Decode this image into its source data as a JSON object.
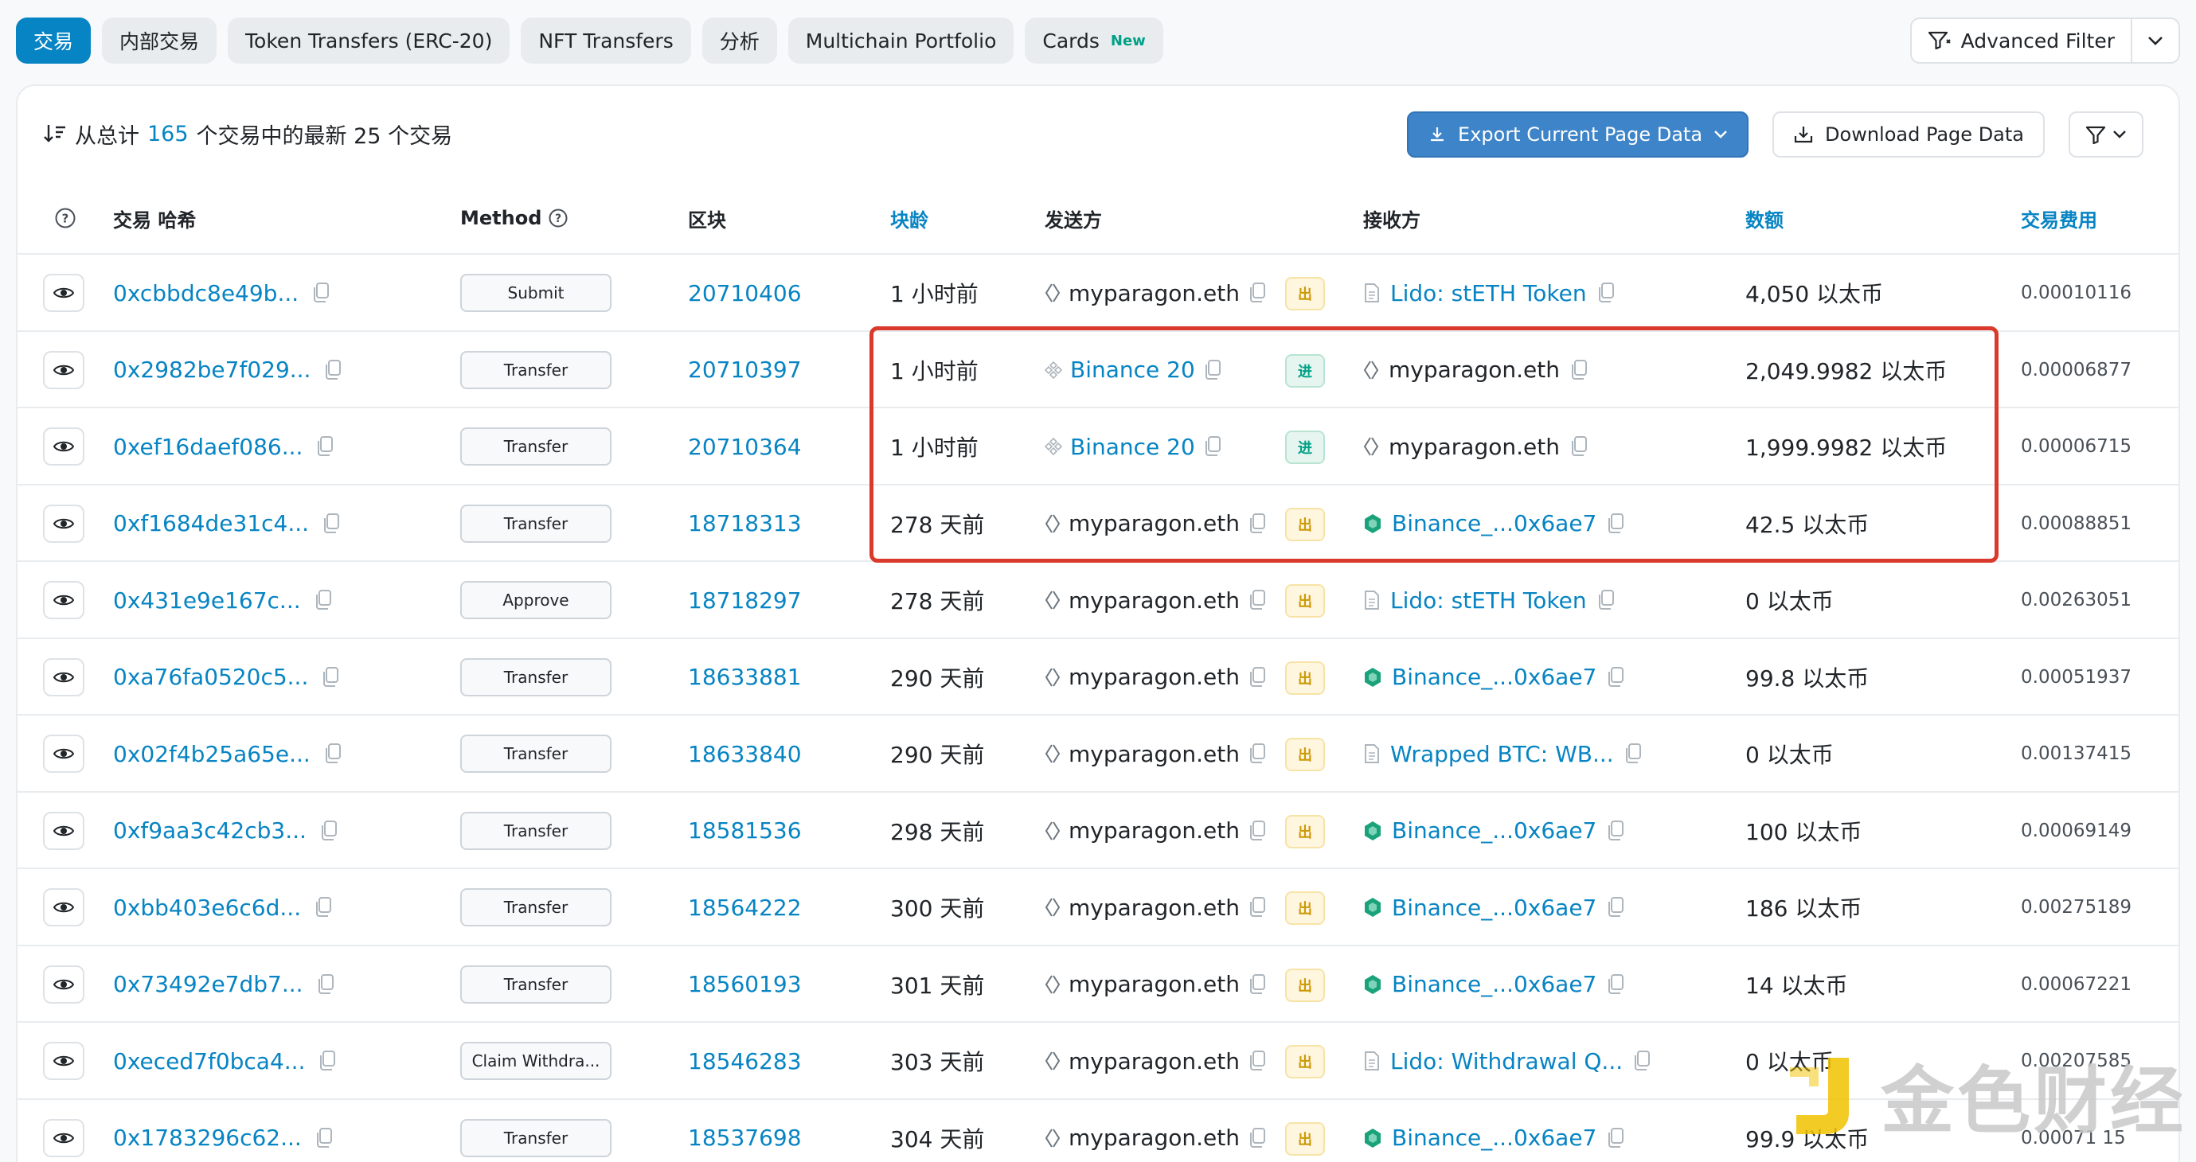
{
  "tabs": [
    {
      "label": "交易",
      "active": true
    },
    {
      "label": "内部交易"
    },
    {
      "label": "Token Transfers (ERC-20)"
    },
    {
      "label": "NFT Transfers"
    },
    {
      "label": "分析"
    },
    {
      "label": "Multichain Portfolio"
    },
    {
      "label": "Cards",
      "badge": "New"
    }
  ],
  "advanced_filter": {
    "label": "Advanced Filter"
  },
  "summary": {
    "prefix": "从总计",
    "total": "165",
    "suffix": "个交易中的最新 25 个交易"
  },
  "actions": {
    "export": "Export Current Page Data",
    "download": "Download Page Data"
  },
  "columns": {
    "hash": "交易 哈希",
    "method": "Method",
    "block": "区块",
    "age": "块龄",
    "from": "发送方",
    "to": "接收方",
    "amount": "数额",
    "fee": "交易费用"
  },
  "rows": [
    {
      "hash": "0xcbbdc8e49b...",
      "method": "Submit",
      "block": "20710406",
      "age": "1 小时前",
      "from": "myparagon.eth",
      "from_type": "ens",
      "dir": "出",
      "to": "Lido: stETH Token",
      "to_type": "contract",
      "amount": "4,050 以太币",
      "fee": "0.00010116"
    },
    {
      "hash": "0x2982be7f029...",
      "method": "Transfer",
      "block": "20710397",
      "age": "1 小时前",
      "from": "Binance 20",
      "from_type": "exchange",
      "dir": "进",
      "to": "myparagon.eth",
      "to_type": "ens",
      "amount": "2,049.9982 以太币",
      "fee": "0.00006877"
    },
    {
      "hash": "0xef16daef086...",
      "method": "Transfer",
      "block": "20710364",
      "age": "1 小时前",
      "from": "Binance 20",
      "from_type": "exchange",
      "dir": "进",
      "to": "myparagon.eth",
      "to_type": "ens",
      "amount": "1,999.9982 以太币",
      "fee": "0.00006715"
    },
    {
      "hash": "0xf1684de31c4...",
      "method": "Transfer",
      "block": "18718313",
      "age": "278 天前",
      "from": "myparagon.eth",
      "from_type": "ens",
      "dir": "出",
      "to": "Binance_...0x6ae7",
      "to_type": "binance",
      "amount": "42.5 以太币",
      "fee": "0.00088851"
    },
    {
      "hash": "0x431e9e167c...",
      "method": "Approve",
      "block": "18718297",
      "age": "278 天前",
      "from": "myparagon.eth",
      "from_type": "ens",
      "dir": "出",
      "to": "Lido: stETH Token",
      "to_type": "contract",
      "amount": "0 以太币",
      "fee": "0.00263051"
    },
    {
      "hash": "0xa76fa0520c5...",
      "method": "Transfer",
      "block": "18633881",
      "age": "290 天前",
      "from": "myparagon.eth",
      "from_type": "ens",
      "dir": "出",
      "to": "Binance_...0x6ae7",
      "to_type": "binance",
      "amount": "99.8 以太币",
      "fee": "0.00051937"
    },
    {
      "hash": "0x02f4b25a65e...",
      "method": "Transfer",
      "block": "18633840",
      "age": "290 天前",
      "from": "myparagon.eth",
      "from_type": "ens",
      "dir": "出",
      "to": "Wrapped BTC: WB...",
      "to_type": "contract",
      "amount": "0 以太币",
      "fee": "0.00137415"
    },
    {
      "hash": "0xf9aa3c42cb3...",
      "method": "Transfer",
      "block": "18581536",
      "age": "298 天前",
      "from": "myparagon.eth",
      "from_type": "ens",
      "dir": "出",
      "to": "Binance_...0x6ae7",
      "to_type": "binance",
      "amount": "100 以太币",
      "fee": "0.00069149"
    },
    {
      "hash": "0xbb403e6c6d...",
      "method": "Transfer",
      "block": "18564222",
      "age": "300 天前",
      "from": "myparagon.eth",
      "from_type": "ens",
      "dir": "出",
      "to": "Binance_...0x6ae7",
      "to_type": "binance",
      "amount": "186 以太币",
      "fee": "0.00275189"
    },
    {
      "hash": "0x73492e7db7...",
      "method": "Transfer",
      "block": "18560193",
      "age": "301 天前",
      "from": "myparagon.eth",
      "from_type": "ens",
      "dir": "出",
      "to": "Binance_...0x6ae7",
      "to_type": "binance",
      "amount": "14 以太币",
      "fee": "0.00067221"
    },
    {
      "hash": "0xeced7f0bca4...",
      "method": "Claim Withdra...",
      "block": "18546283",
      "age": "303 天前",
      "from": "myparagon.eth",
      "from_type": "ens",
      "dir": "出",
      "to": "Lido: Withdrawal Q...",
      "to_type": "contract",
      "amount": "0 以太币",
      "fee": "0.00207585"
    },
    {
      "hash": "0x1783296c62...",
      "method": "Transfer",
      "block": "18537698",
      "age": "304 天前",
      "from": "myparagon.eth",
      "from_type": "ens",
      "dir": "出",
      "to": "Binance_...0x6ae7",
      "to_type": "binance",
      "amount": "99.9 以太币",
      "fee": "0.00071 15"
    }
  ],
  "watermark": {
    "text": "金色财经"
  },
  "colors": {
    "accent": "#0784c3",
    "highlight": "#d93a2b",
    "out": "#cc9a06",
    "in": "#00a186",
    "binance": "#1aa37a"
  }
}
